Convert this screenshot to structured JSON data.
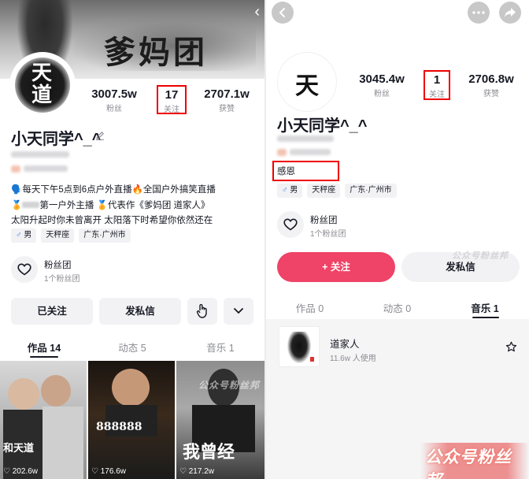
{
  "left": {
    "banner": {
      "text": "爹妈团"
    },
    "avatar": {
      "text": "天道"
    },
    "stats": [
      {
        "num": "3007.5w",
        "label": "粉丝"
      },
      {
        "num": "17",
        "label": "关注"
      },
      {
        "num": "2707.1w",
        "label": "获赞"
      }
    ],
    "nickname": "小天同学^_^",
    "bio": {
      "line1": "🗣️每天下午5点到6点户外直播🔥全国户外搞笑直播",
      "line2a": "🏅",
      "line2b": "第一户外主播 🏅代表作《爹妈团 道家人》",
      "line3": "太阳升起时你未曾离开  太阳落下时希望你依然还在"
    },
    "tags": [
      {
        "icon": "♂",
        "label": "男"
      },
      {
        "label": "天秤座"
      },
      {
        "label": "广东·广州市"
      }
    ],
    "fan": {
      "title": "粉丝团",
      "sub": "1个粉丝团"
    },
    "buttons": {
      "followed": "已关注",
      "message": "发私信"
    },
    "tabs": [
      {
        "label": "作品 14"
      },
      {
        "label": "动态 5"
      },
      {
        "label": "音乐 1"
      }
    ],
    "videos": [
      {
        "count": "♡ 202.6w",
        "caption": "和天道"
      },
      {
        "count": "♡ 176.6w",
        "caption": "888888"
      },
      {
        "count": "♡ 217.2w",
        "caption": "我曾经"
      }
    ]
  },
  "right": {
    "avatar": {
      "text": "天"
    },
    "stats": [
      {
        "num": "3045.4w",
        "label": "粉丝"
      },
      {
        "num": "1",
        "label": "关注"
      },
      {
        "num": "2706.8w",
        "label": "获赞"
      }
    ],
    "nickname": "小天同学^_^",
    "bio": "感恩",
    "tags": [
      {
        "icon": "♂",
        "label": "男"
      },
      {
        "label": "天秤座"
      },
      {
        "label": "广东·广州市"
      }
    ],
    "fan": {
      "title": "粉丝团",
      "sub": "1个粉丝团"
    },
    "buttons": {
      "follow": "+ 关注",
      "message": "发私信"
    },
    "tabs": [
      {
        "label": "作品 0"
      },
      {
        "label": "动态 0"
      },
      {
        "label": "音乐 1"
      }
    ],
    "song": {
      "title": "道家人",
      "sub": "11.6w 人使用"
    }
  },
  "watermark": {
    "text": "公众号粉丝邦"
  },
  "colors": {
    "accent": "#ef4367",
    "highlight_box": "#e00000",
    "text": "#161823",
    "muted": "#8a8b91"
  }
}
